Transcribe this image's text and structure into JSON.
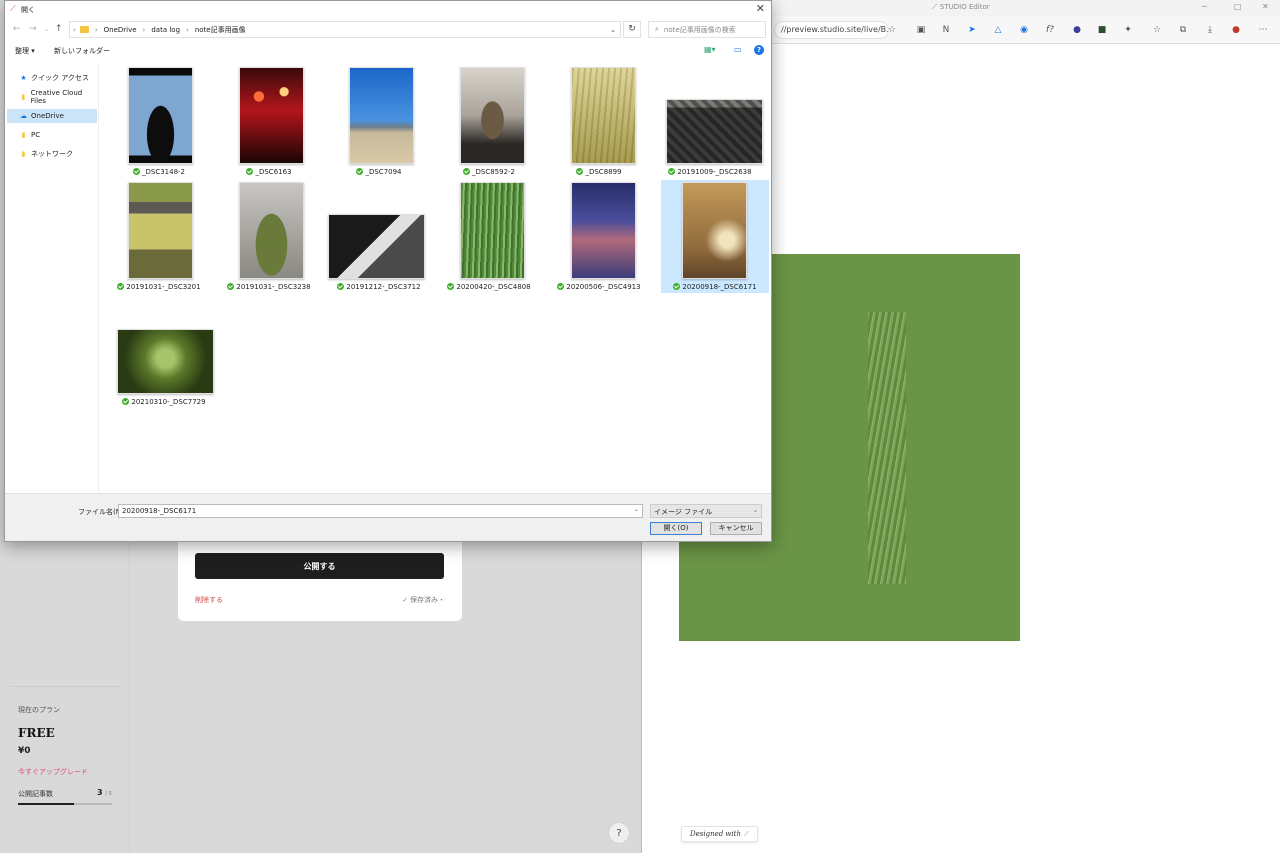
{
  "dashboard": {
    "publish_label": "公開する",
    "delete_label": "削除する",
    "saved_label": "保存済み・",
    "plan": {
      "label": "現在のプラン",
      "name": "FREE",
      "price": "¥0",
      "upgrade_label": "今すぐアップグレード",
      "count_label": "公開記事数",
      "count_value": "3",
      "count_max": "/ 5",
      "progress_fraction": 0.6
    },
    "help_label": "?"
  },
  "preview_browser": {
    "title": "STUDIO Editor",
    "url": "//preview.studio.site/live/B...",
    "designed_with": "Designed with",
    "colors": {
      "block_bg": "#6a9446"
    }
  },
  "dialog": {
    "title": "開く",
    "path": [
      "OneDrive",
      "data log",
      "note記事用画像"
    ],
    "search_placeholder": "note記事用画像の検索",
    "organize_label": "整理 ▾",
    "new_folder_label": "新しいフォルダー",
    "nav_items": [
      {
        "label": "クイック アクセス",
        "icon": "star-icon"
      },
      {
        "label": "Creative Cloud Files",
        "icon": "folder-icon"
      },
      {
        "label": "OneDrive",
        "icon": "cloud-icon",
        "selected": true
      },
      {
        "label": "PC",
        "icon": "folder-icon"
      },
      {
        "label": "ネットワーク",
        "icon": "folder-icon"
      }
    ],
    "files": [
      {
        "name": "_DSC3148-2"
      },
      {
        "name": "_DSC6163"
      },
      {
        "name": "_DSC7094"
      },
      {
        "name": "_DSC8592-2"
      },
      {
        "name": "_DSC8899"
      },
      {
        "name": "20191009-_DSC2638"
      },
      {
        "name": "20191031-_DSC3201"
      },
      {
        "name": "20191031-_DSC3238"
      },
      {
        "name": "20191212-_DSC3712"
      },
      {
        "name": "20200420-_DSC4808"
      },
      {
        "name": "20200506-_DSC4913"
      },
      {
        "name": "20200918-_DSC6171",
        "selected": true
      },
      {
        "name": "20210310-_DSC7729"
      }
    ],
    "filename_label": "ファイル名(N):",
    "filename_value": "20200918-_DSC6171",
    "filetype_value": "イメージ ファイル",
    "open_label": "開く(O)",
    "cancel_label": "キャンセル"
  }
}
